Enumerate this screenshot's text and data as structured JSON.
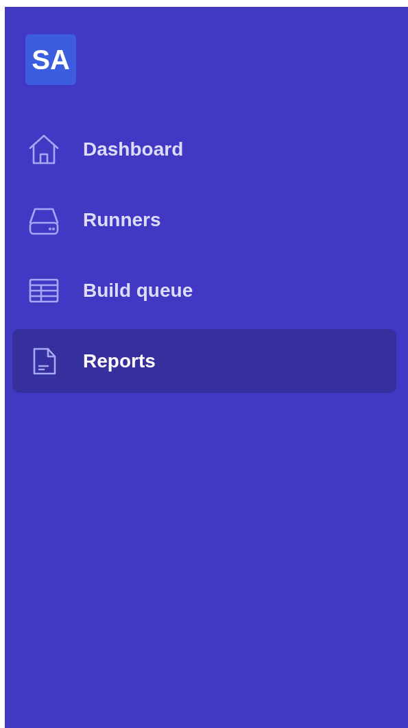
{
  "logo": {
    "text": "SA"
  },
  "nav": [
    {
      "label": "Dashboard",
      "kind": "home",
      "selected": false
    },
    {
      "label": "Runners",
      "kind": "drive",
      "selected": false
    },
    {
      "label": "Build queue",
      "kind": "table",
      "selected": false
    },
    {
      "label": "Reports",
      "kind": "document",
      "selected": true
    }
  ]
}
